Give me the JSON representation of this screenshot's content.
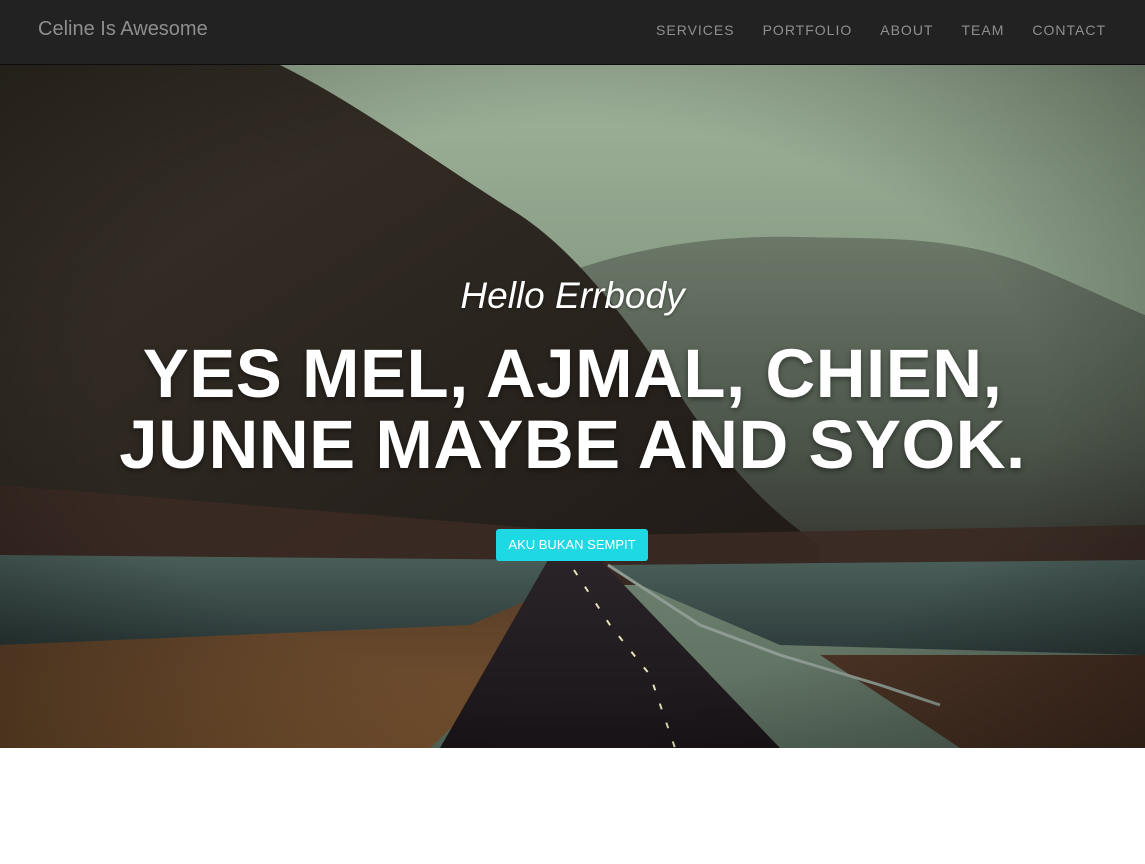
{
  "navbar": {
    "brand": "Celine Is Awesome",
    "links": [
      {
        "label": "SERVICES"
      },
      {
        "label": "PORTFOLIO"
      },
      {
        "label": "ABOUT"
      },
      {
        "label": "TEAM"
      },
      {
        "label": "CONTACT"
      }
    ]
  },
  "hero": {
    "lead_in": "Hello Errbody",
    "heading": "YES MEL, AJMAL, CHIEN, JUNNE MAYBE AND SYOK.",
    "button_label": "AKU BUKAN SEMPIT",
    "background": "photo-mountains-road-lake"
  },
  "colors": {
    "navbar_bg": "#222222",
    "nav_text": "#8f8f8f",
    "accent": "#1ed9e4",
    "heading_text": "#ffffff"
  }
}
